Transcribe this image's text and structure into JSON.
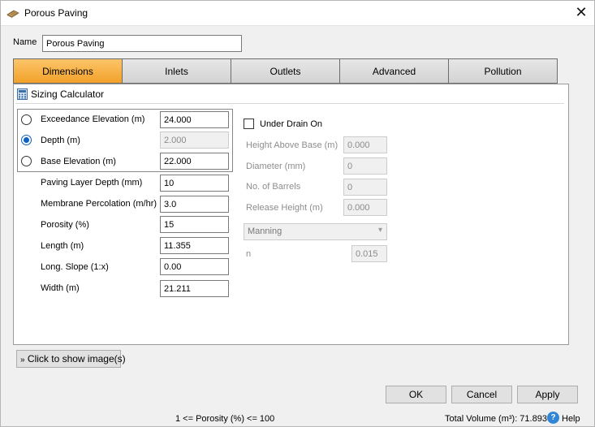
{
  "window": {
    "title": "Porous Paving",
    "close_glyph": "✕"
  },
  "name_field": {
    "label": "Name",
    "value": "Porous Paving"
  },
  "tabs": [
    {
      "label": "Dimensions",
      "active": true
    },
    {
      "label": "Inlets",
      "active": false
    },
    {
      "label": "Outlets",
      "active": false
    },
    {
      "label": "Advanced",
      "active": false
    },
    {
      "label": "Pollution",
      "active": false
    }
  ],
  "sizing_calculator": {
    "label": "Sizing Calculator",
    "icon": "calculator-icon"
  },
  "radio_fields": [
    {
      "label": "Exceedance Elevation (m)",
      "value": "24.000",
      "selected": false
    },
    {
      "label": "Depth (m)",
      "value": "2.000",
      "selected": true
    },
    {
      "label": "Base Elevation (m)",
      "value": "22.000",
      "selected": false
    }
  ],
  "fields": [
    {
      "label": "Paving Layer Depth (mm)",
      "value": "10"
    },
    {
      "label": "Membrane Percolation (m/hr)",
      "value": "3.0"
    },
    {
      "label": "Porosity (%)",
      "value": "15"
    },
    {
      "label": "Length (m)",
      "value": "11.355"
    },
    {
      "label": "Long. Slope (1:x)",
      "value": "0.00"
    },
    {
      "label": "Width (m)",
      "value": "21.211"
    }
  ],
  "under_drain": {
    "label": "Under Drain On",
    "checked": false,
    "fields": [
      {
        "label": "Height Above Base (m)",
        "value": "0.000"
      },
      {
        "label": "Diameter (mm)",
        "value": "0"
      },
      {
        "label": "No. of Barrels",
        "value": "0"
      },
      {
        "label": "Release Height (m)",
        "value": "0.000"
      }
    ],
    "method": "Manning",
    "n_label": "n",
    "n_value": "0.015"
  },
  "show_images_button": "Click to show image(s)",
  "buttons": {
    "ok": "OK",
    "cancel": "Cancel",
    "apply": "Apply"
  },
  "status": {
    "hint": "1 <= Porosity (%) <= 100",
    "total_volume": "Total Volume (m³): 71.893",
    "help": "Help"
  },
  "colors": {
    "active_tab": "#f2a129",
    "radio_accent": "#0b62c4",
    "help_icon": "#2f86d6"
  }
}
